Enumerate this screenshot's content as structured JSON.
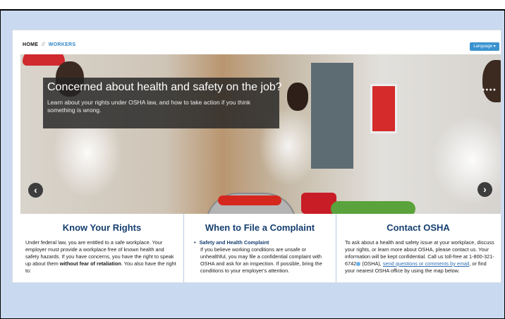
{
  "breadcrumb": {
    "home": "HOME",
    "separator": "//",
    "current": "WORKERS"
  },
  "language_button": "Language ▾",
  "hero": {
    "headline": "Concerned about health and safety on the job?",
    "subtext": "Learn about your rights under OSHA law, and how to take action if you think something is wrong.",
    "prev_icon": "arrow-left-circle-icon",
    "next_icon": "arrow-right-circle-icon",
    "dots": "●●●●"
  },
  "columns": {
    "rights": {
      "title": "Know Your Rights",
      "text_1": "Under federal law, you are entitled to a safe workplace. Your employer must provide a workplace free of known health and safety hazards. If you have concerns, you have the right to speak up about them ",
      "text_bold": "without fear of retaliation",
      "text_2": ". You also have the right to:"
    },
    "complaint": {
      "title": "When to File a Complaint",
      "bullet": "Safety and Health Complaint",
      "text": "If you believe working conditions are unsafe or unhealthful, you may file a confidential complaint with OSHA and ask for an inspection. If possible, bring the conditions to your employer's attention."
    },
    "contact": {
      "title": "Contact OSHA",
      "text_1": "To ask about a health and safety issue at your workplace, discuss your rights, or learn more about OSHA, please contact us. Your information will be kept confidential. Call us toll-free at 1-800-321-6742",
      "text_2": " (OSHA), ",
      "link_1": "send questions or comments by email",
      "text_3": ", or find your nearest OSHA office by using the map below."
    }
  },
  "colors": {
    "accent": "#163f70",
    "link": "#2f85c4",
    "frame": "#c9d9f0"
  }
}
